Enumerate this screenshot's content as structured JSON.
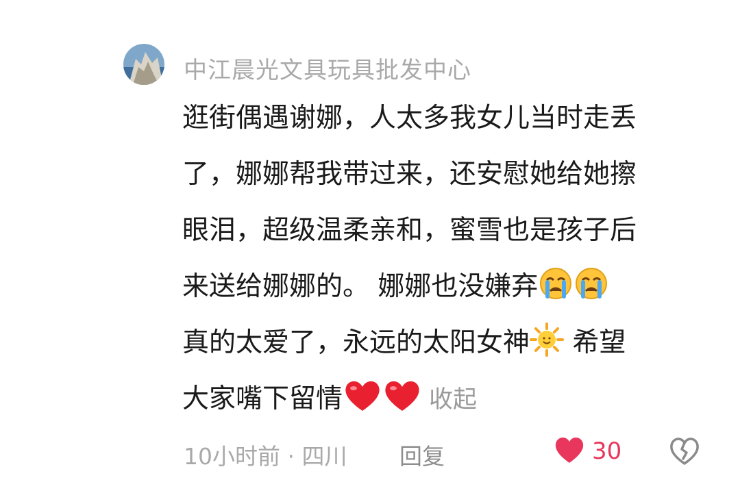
{
  "top_partial_text": "　　　　　　　　",
  "comment": {
    "username": "中江晨光文具玩具批发中心",
    "lines": [
      "逛街偶遇谢娜，人太多我女儿当时走丢",
      "了，娜娜帮我带过来，还安慰她给她擦",
      "眼泪，超级温柔亲和，蜜雪也是孩子后",
      "来送给娜娜的。 娜娜也没嫌弃",
      "真的太爱了，永远的太阳女神",
      "大家嘴下留情"
    ],
    "line5_tail": " 希望",
    "collapse_label": "收起",
    "meta": "10小时前 · 四川",
    "reply_label": "回复",
    "like_count": "30"
  },
  "colors": {
    "like": "#e8365d",
    "username": "#a9a9a9",
    "text": "#1a1a1a"
  },
  "icons": [
    "avatar",
    "crying-emoji",
    "sun-emoji",
    "heart-emoji",
    "like-heart-icon",
    "broken-heart-icon"
  ]
}
